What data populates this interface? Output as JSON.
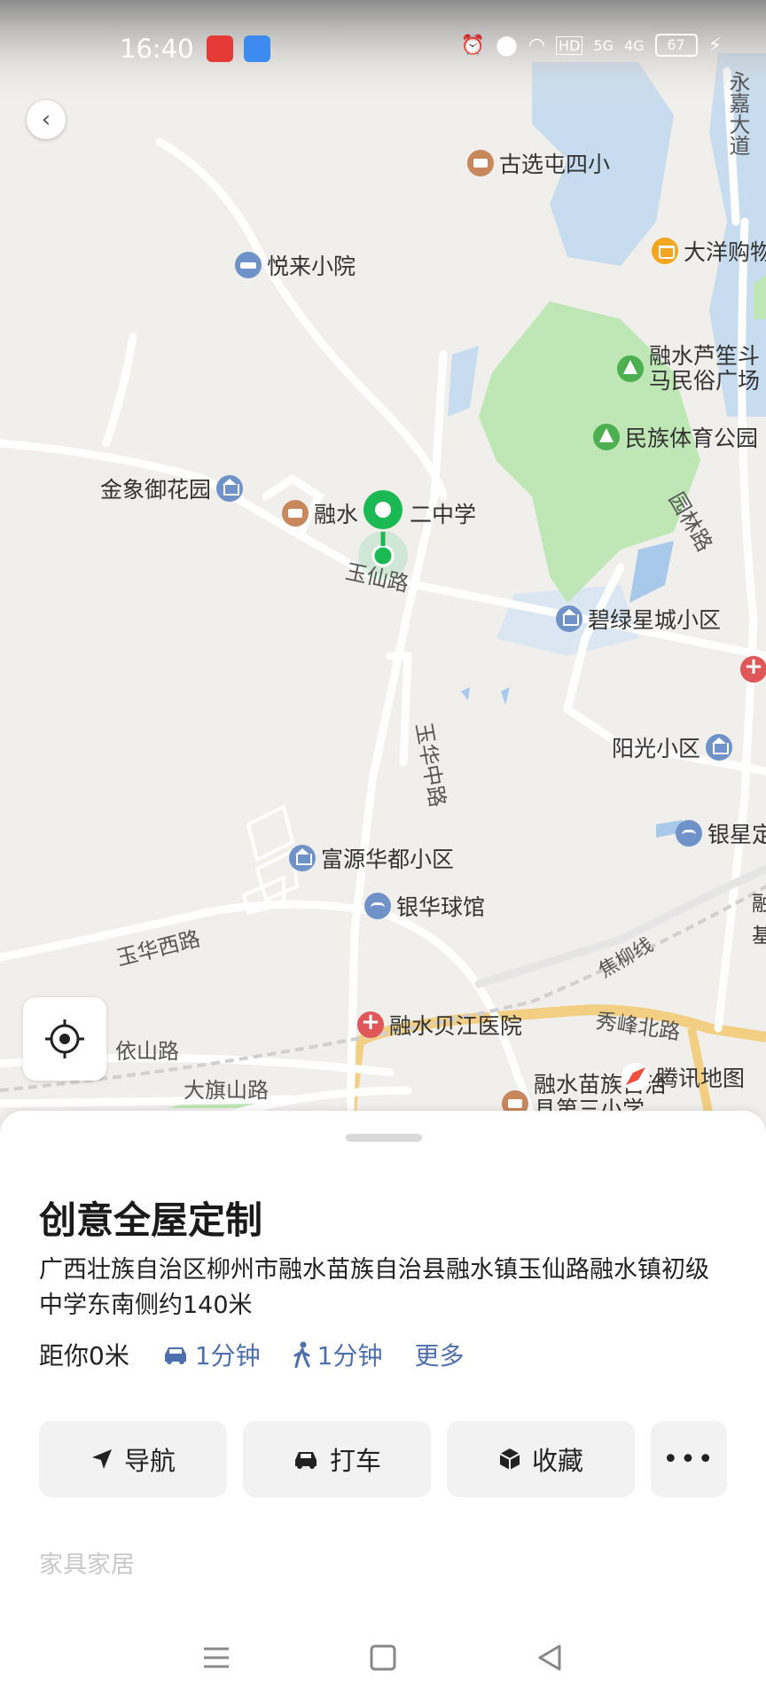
{
  "status_bar": {
    "time": "16:40",
    "network_labels": [
      "HD",
      "5G",
      "4G"
    ],
    "battery": "67"
  },
  "map": {
    "labels": {
      "guxuan_school": "古选屯四小",
      "dayang": "大洋购物",
      "yuelai": "悦来小院",
      "lusheng_1": "融水芦笙斗",
      "lusheng_2": "马民俗广场",
      "tiyu_park": "民族体育公园",
      "jinxiang": "金象御花园",
      "school_2_a": "融水",
      "school_2_b": "二中学",
      "yuxian_road": "玉仙路",
      "yuanlin_road": "园林路",
      "bilv": "碧绿星城小区",
      "yanguang": "阳光小区",
      "yuhua_zhong": "玉华中路",
      "yinxing": "银星定",
      "fuyuan": "富源华都小区",
      "yinhua": "银华球馆",
      "yuhua_xi": "玉华西路",
      "jiaoliu": "焦柳线",
      "yishan": "依山路",
      "beijiang": "融水贝江医院",
      "xiufeng": "秀峰北路",
      "daqishan": "大旗山路",
      "miaozu_1": "融水苗族自治",
      "miaozu_2": "县第三小学",
      "yongjia": "永嘉大道",
      "rong_edge": "融",
      "ji_edge": "基"
    },
    "brand": "腾讯地图"
  },
  "place": {
    "name": "创意全屋定制",
    "address": "广西壮族自治区柳州市融水苗族自治县融水镇玉仙路融水镇初级中学东南侧约140米",
    "distance": "距你0米",
    "drive_time": "1分钟",
    "walk_time": "1分钟",
    "more": "更多",
    "category": "家具家居"
  },
  "actions": {
    "navigate": "导航",
    "taxi": "打车",
    "favorite": "收藏"
  },
  "colors": {
    "marker": "#1bb954",
    "link": "#4e6fae",
    "park_green": "#bfe6b5",
    "water": "#c7dcef"
  }
}
